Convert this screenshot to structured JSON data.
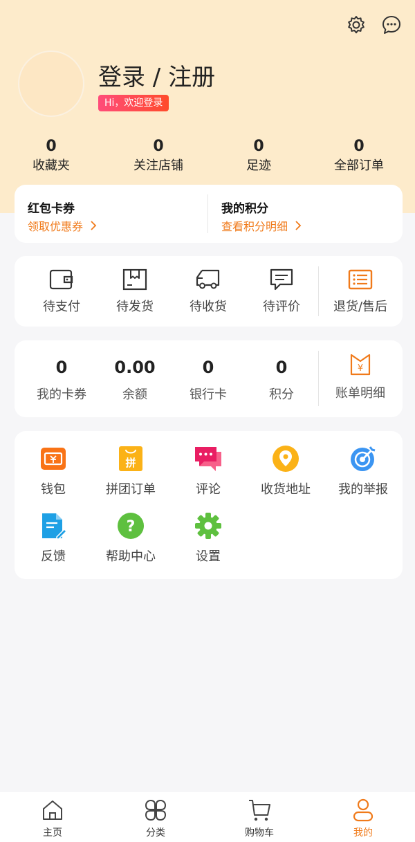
{
  "header": {
    "login_title": "登录 / 注册",
    "greeting_badge": "Hi，欢迎登录",
    "settings_icon": "gear-icon",
    "message_icon": "chat-bubble-icon"
  },
  "stats": [
    {
      "value": "0",
      "label": "收藏夹"
    },
    {
      "value": "0",
      "label": "关注店铺"
    },
    {
      "value": "0",
      "label": "足迹"
    },
    {
      "value": "0",
      "label": "全部订单"
    }
  ],
  "coupons": {
    "left_title": "红包卡券",
    "left_link": "领取优惠券",
    "right_title": "我的积分",
    "right_link": "查看积分明细"
  },
  "orders": [
    {
      "label": "待支付",
      "icon": "wallet-icon"
    },
    {
      "label": "待发货",
      "icon": "box-icon"
    },
    {
      "label": "待收货",
      "icon": "truck-icon"
    },
    {
      "label": "待评价",
      "icon": "comment-icon"
    },
    {
      "label": "退货/售后",
      "icon": "list-icon"
    }
  ],
  "wallet": [
    {
      "value": "0",
      "label": "我的卡券"
    },
    {
      "value": "0.00",
      "label": "余额"
    },
    {
      "value": "0",
      "label": "银行卡"
    },
    {
      "value": "0",
      "label": "积分"
    },
    {
      "label": "账单明细",
      "icon": "bill-icon"
    }
  ],
  "services": [
    {
      "label": "钱包",
      "icon": "wallet-ticket-icon"
    },
    {
      "label": "拼团订单",
      "icon": "group-buy-icon"
    },
    {
      "label": "评论",
      "icon": "comment-bubble-icon"
    },
    {
      "label": "收货地址",
      "icon": "location-pin-icon"
    },
    {
      "label": "我的举报",
      "icon": "target-icon"
    },
    {
      "label": "反馈",
      "icon": "feedback-doc-icon"
    },
    {
      "label": "帮助中心",
      "icon": "help-icon"
    },
    {
      "label": "设置",
      "icon": "settings-gear-icon"
    }
  ],
  "tabbar": [
    {
      "label": "主页",
      "icon": "home-icon"
    },
    {
      "label": "分类",
      "icon": "category-icon"
    },
    {
      "label": "购物车",
      "icon": "cart-icon"
    },
    {
      "label": "我的",
      "icon": "user-icon",
      "active": true
    }
  ],
  "colors": {
    "accent": "#f07a1a",
    "header_bg": "#fdebcb",
    "page_bg": "#f6f6f8"
  }
}
